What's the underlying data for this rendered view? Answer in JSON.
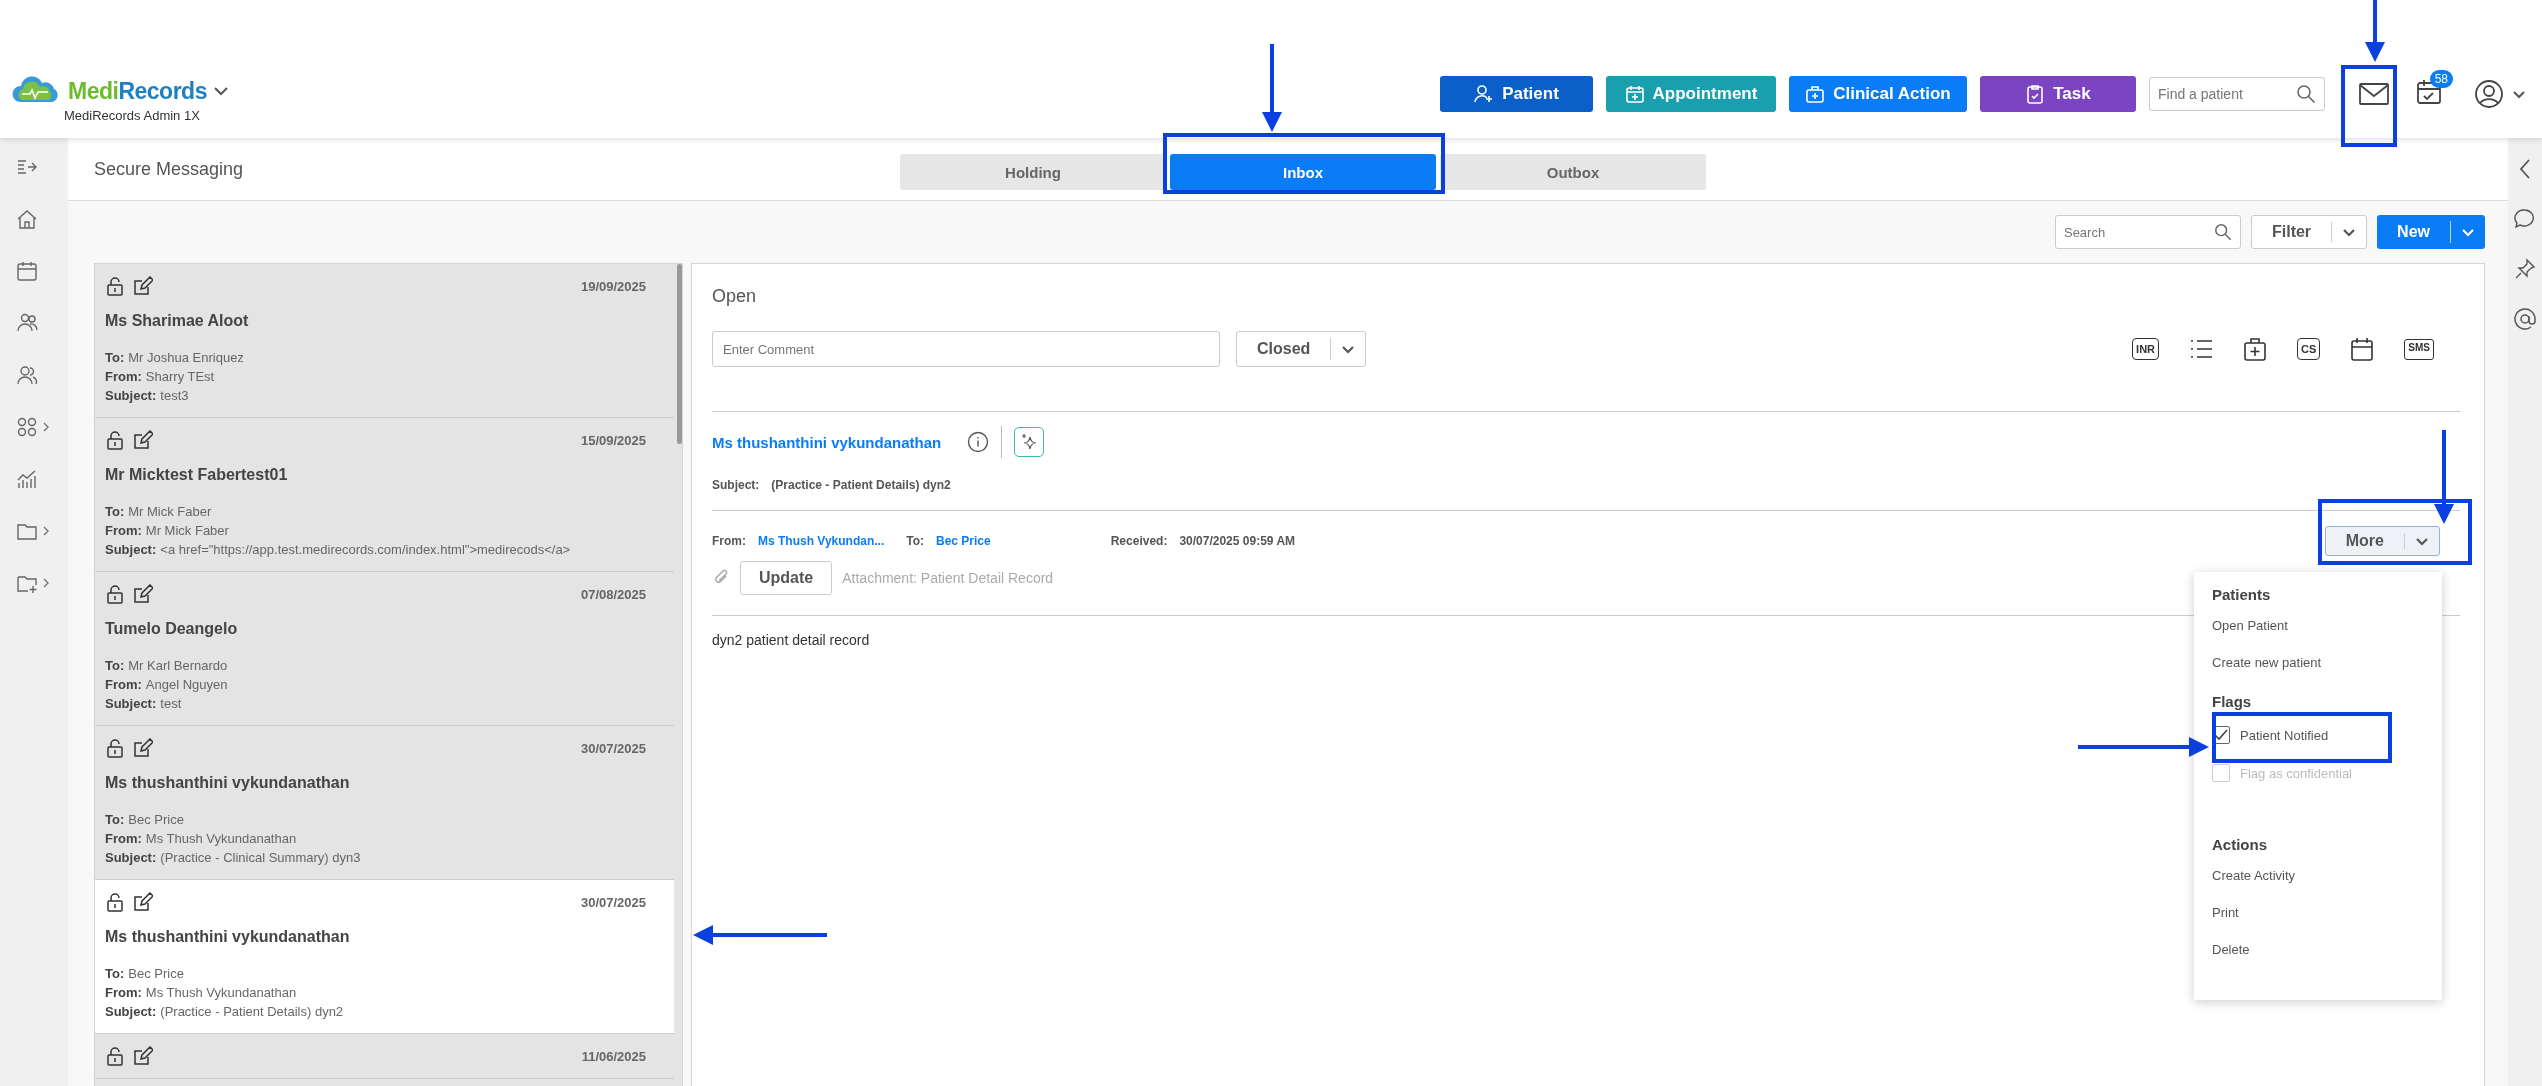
{
  "header": {
    "brand_parts": [
      "Medi",
      "Records"
    ],
    "subtitle": "MediRecords Admin 1X",
    "actions": [
      {
        "kind": "patient",
        "label": "Patient",
        "color": "#0a5fc8"
      },
      {
        "kind": "appointment",
        "label": "Appointment",
        "color": "#1a9fae"
      },
      {
        "kind": "clinical",
        "label": "Clinical Action",
        "color": "#0a7cf5"
      },
      {
        "kind": "task",
        "label": "Task",
        "color": "#7b44c2"
      }
    ],
    "patient_search": {
      "placeholder": "Find a patient"
    },
    "task_badge": "58"
  },
  "left_nav": [
    {
      "kind": "expand",
      "submenu": false
    },
    {
      "kind": "home",
      "submenu": false
    },
    {
      "kind": "calendar",
      "submenu": false
    },
    {
      "kind": "patients",
      "submenu": false
    },
    {
      "kind": "users",
      "submenu": false
    },
    {
      "kind": "apps",
      "submenu": true
    },
    {
      "kind": "chart",
      "submenu": false
    },
    {
      "kind": "folder",
      "submenu": true
    },
    {
      "kind": "folder-plus",
      "submenu": true
    }
  ],
  "right_rail": [
    {
      "kind": "chevron"
    },
    {
      "kind": "chat"
    },
    {
      "kind": "pin"
    },
    {
      "kind": "at"
    }
  ],
  "page_title": "Secure Messaging",
  "tabs": [
    {
      "label": "Holding",
      "selected": false
    },
    {
      "label": "Inbox",
      "selected": true
    },
    {
      "label": "Outbox",
      "selected": false
    }
  ],
  "toolbar": {
    "search_placeholder": "Search",
    "filter": "Filter",
    "new": "New"
  },
  "messages": [
    {
      "date": "19/09/2025",
      "name": "Ms Sharimae Aloot",
      "fields": [
        {
          "label": "To:",
          "value": "Mr Joshua Enriquez"
        },
        {
          "label": "From:",
          "value": "Sharry TEst"
        },
        {
          "label": "Subject:",
          "value": "test3"
        }
      ],
      "selected": false
    },
    {
      "date": "15/09/2025",
      "name": "Mr Micktest Fabertest01",
      "fields": [
        {
          "label": "To:",
          "value": "Mr Mick Faber"
        },
        {
          "label": "From:",
          "value": "Mr Mick Faber"
        },
        {
          "label": "Subject:",
          "value": "<a href=\"https://app.test.medirecords.com/index.html\">medirecods</a>"
        }
      ],
      "selected": false
    },
    {
      "date": "07/08/2025",
      "name": "Tumelo Deangelo",
      "fields": [
        {
          "label": "To:",
          "value": "Mr Karl Bernardo"
        },
        {
          "label": "From:",
          "value": "Angel Nguyen"
        },
        {
          "label": "Subject:",
          "value": "test"
        }
      ],
      "selected": false
    },
    {
      "date": "30/07/2025",
      "name": "Ms thushanthini vykundanathan",
      "fields": [
        {
          "label": "To:",
          "value": "Bec Price"
        },
        {
          "label": "From:",
          "value": "Ms Thush Vykundanathan"
        },
        {
          "label": "Subject:",
          "value": "(Practice - Clinical Summary) dyn3"
        }
      ],
      "selected": false
    },
    {
      "date": "30/07/2025",
      "name": "Ms thushanthini vykundanathan",
      "fields": [
        {
          "label": "To:",
          "value": "Bec Price"
        },
        {
          "label": "From:",
          "value": "Ms Thush Vykundanathan"
        },
        {
          "label": "Subject:",
          "value": "(Practice - Patient Details) dyn2"
        }
      ],
      "selected": true
    },
    {
      "date": "11/06/2025",
      "selected": false
    }
  ],
  "detail": {
    "status_title": "Open",
    "comment_placeholder": "Enter Comment",
    "status_select": "Closed",
    "tools": [
      {
        "kind": "inr",
        "text": "INR"
      },
      {
        "kind": "list"
      },
      {
        "kind": "medkit"
      },
      {
        "kind": "cs",
        "text": "CS"
      },
      {
        "kind": "calendar"
      },
      {
        "kind": "sms",
        "text": "SMS"
      }
    ],
    "patient_name": "Ms thushanthini vykundanathan",
    "subject_label": "Subject:",
    "subject": "(Practice - Patient Details) dyn2",
    "from_label": "From:",
    "from": "Ms Thush Vykundan...",
    "to_label": "To:",
    "to": "Bec Price",
    "received_label": "Received:",
    "received": "30/07/2025 09:59 AM",
    "more": "More",
    "update": "Update",
    "attachment": "Attachment: Patient Detail Record",
    "body": "dyn2 patient detail record"
  },
  "more_menu": {
    "sections": [
      {
        "title": "Patients",
        "items": [
          {
            "kind": "action",
            "label": "Open Patient"
          },
          {
            "kind": "action",
            "label": "Create new patient"
          }
        ]
      },
      {
        "title": "Flags",
        "items": [
          {
            "kind": "checkbox",
            "label": "Patient Notified",
            "checked": true,
            "disabled": false
          },
          {
            "kind": "checkbox",
            "label": "Flag as confidential",
            "checked": false,
            "disabled": true
          }
        ]
      },
      {
        "title": "Actions",
        "items": [
          {
            "kind": "action",
            "label": "Create Activity"
          },
          {
            "kind": "action",
            "label": "Print"
          },
          {
            "kind": "action",
            "label": "Delete"
          }
        ]
      }
    ]
  }
}
